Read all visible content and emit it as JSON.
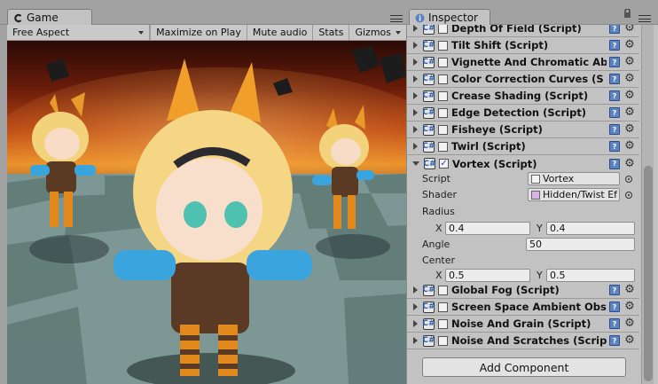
{
  "game": {
    "tab_label": "Game",
    "aspect": "Free Aspect",
    "toolbar": {
      "maximize": "Maximize on Play",
      "mute": "Mute audio",
      "stats": "Stats",
      "gizmos": "Gizmos"
    }
  },
  "inspector": {
    "tab_label": "Inspector",
    "components": [
      {
        "name": "Depth Of Field (Script)",
        "enabled": false
      },
      {
        "name": "Tilt Shift (Script)",
        "enabled": false
      },
      {
        "name": "Vignette And Chromatic Ab",
        "enabled": false
      },
      {
        "name": "Color Correction Curves (S",
        "enabled": false
      },
      {
        "name": "Crease Shading (Script)",
        "enabled": false
      },
      {
        "name": "Edge Detection (Script)",
        "enabled": false
      },
      {
        "name": "Fisheye (Script)",
        "enabled": false
      },
      {
        "name": "Twirl (Script)",
        "enabled": false
      },
      {
        "name": "Vortex (Script)",
        "enabled": true,
        "expanded": true
      },
      {
        "name": "Global Fog (Script)",
        "enabled": false
      },
      {
        "name": "Screen Space Ambient Obs",
        "enabled": false
      },
      {
        "name": "Noise And Grain (Script)",
        "enabled": false
      },
      {
        "name": "Noise And Scratches (Scrip",
        "enabled": false
      }
    ],
    "vortex": {
      "script_label": "Script",
      "script_value": "Vortex",
      "shader_label": "Shader",
      "shader_value": "Hidden/Twist Ef",
      "radius_label": "Radius",
      "radius_x_label": "X",
      "radius_x": "0.4",
      "radius_y_label": "Y",
      "radius_y": "0.4",
      "angle_label": "Angle",
      "angle": "50",
      "center_label": "Center",
      "center_x_label": "X",
      "center_x": "0.5",
      "center_y_label": "Y",
      "center_y": "0.5"
    },
    "add_component": "Add Component",
    "icons": {
      "script": "C#",
      "help": "?",
      "gear": "⚙"
    }
  }
}
